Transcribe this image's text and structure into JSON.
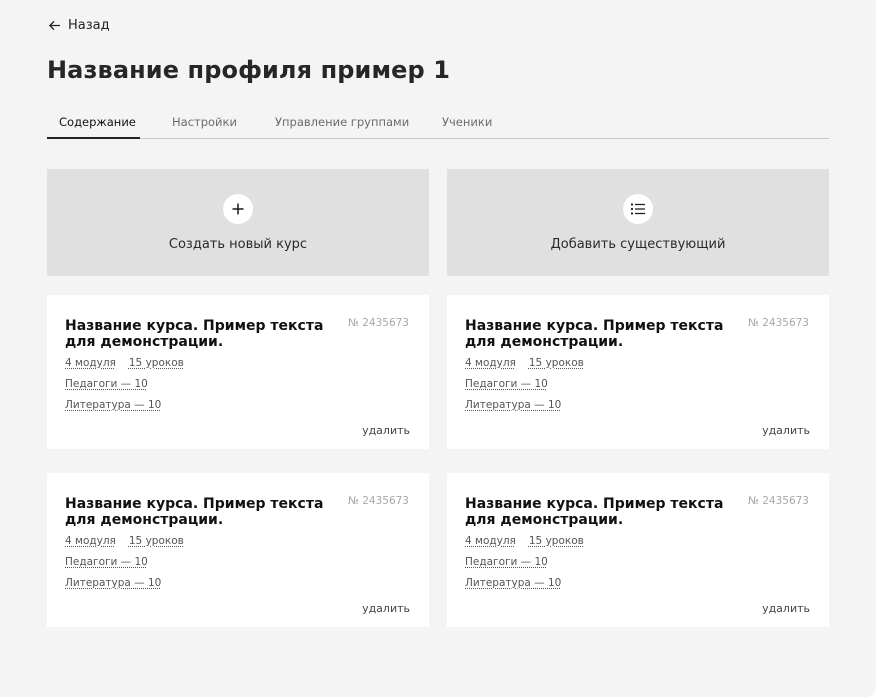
{
  "header": {
    "back_label": "Назад",
    "title": "Название профиля пример 1"
  },
  "tabs": [
    {
      "label": "Содержание",
      "active": true
    },
    {
      "label": "Настройки",
      "active": false
    },
    {
      "label": "Управление группами",
      "active": false
    },
    {
      "label": "Ученики",
      "active": false
    }
  ],
  "actions": {
    "create": {
      "label": "Создать новый курс",
      "icon": "plus-icon"
    },
    "add_existing": {
      "label": "Добавить существующий",
      "icon": "list-icon"
    }
  },
  "courses": [
    {
      "title": "Название курса. Пример текста для демонстрации.",
      "number": "№ 2435673",
      "modules": "4 модуля",
      "lessons": "15 уроков",
      "teachers": "Педагоги — 10",
      "literature": "Литература — 10",
      "delete_label": "удалить"
    },
    {
      "title": "Название курса. Пример текста для демонстрации.",
      "number": "№ 2435673",
      "modules": "4 модуля",
      "lessons": "15 уроков",
      "teachers": "Педагоги — 10",
      "literature": "Литература — 10",
      "delete_label": "удалить"
    },
    {
      "title": "Название курса. Пример текста для демонстрации.",
      "number": "№ 2435673",
      "modules": "4 модуля",
      "lessons": "15 уроков",
      "teachers": "Педагоги — 10",
      "literature": "Литература — 10",
      "delete_label": "удалить"
    },
    {
      "title": "Название курса. Пример текста для демонстрации.",
      "number": "№ 2435673",
      "modules": "4 модуля",
      "lessons": "15 уроков",
      "teachers": "Педагоги — 10",
      "literature": "Литература — 10",
      "delete_label": "удалить"
    }
  ],
  "colors": {
    "page_background": "#f4f4f4",
    "action_card_background": "#e0e0e0",
    "card_background": "#ffffff",
    "active_tab_underline": "#222222"
  }
}
